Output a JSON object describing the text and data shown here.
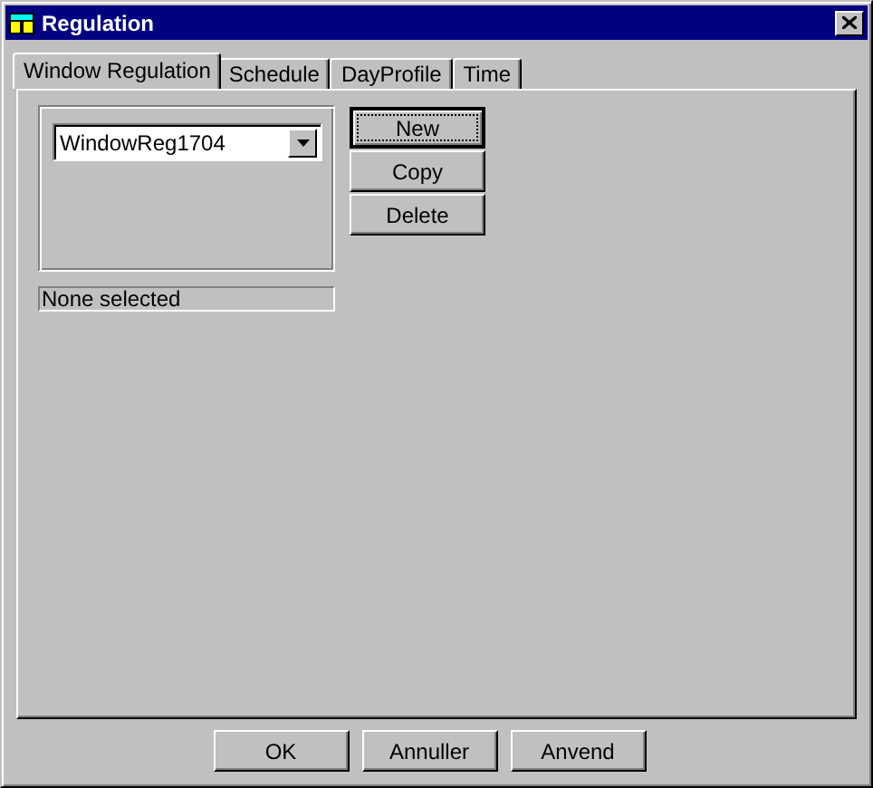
{
  "window": {
    "title": "Regulation"
  },
  "tabs": [
    {
      "label": "Window Regulation",
      "selected": true
    },
    {
      "label": "Schedule",
      "selected": false
    },
    {
      "label": "DayProfile",
      "selected": false
    },
    {
      "label": "Time",
      "selected": false
    }
  ],
  "combo": {
    "value": "WindowReg1704"
  },
  "side_buttons": [
    {
      "label": "New",
      "focused": true
    },
    {
      "label": "Copy",
      "focused": false
    },
    {
      "label": "Delete",
      "focused": false
    }
  ],
  "status_field": {
    "value": "None selected"
  },
  "buttons": [
    {
      "label": "OK"
    },
    {
      "label": "Annuller"
    },
    {
      "label": "Anvend"
    }
  ]
}
